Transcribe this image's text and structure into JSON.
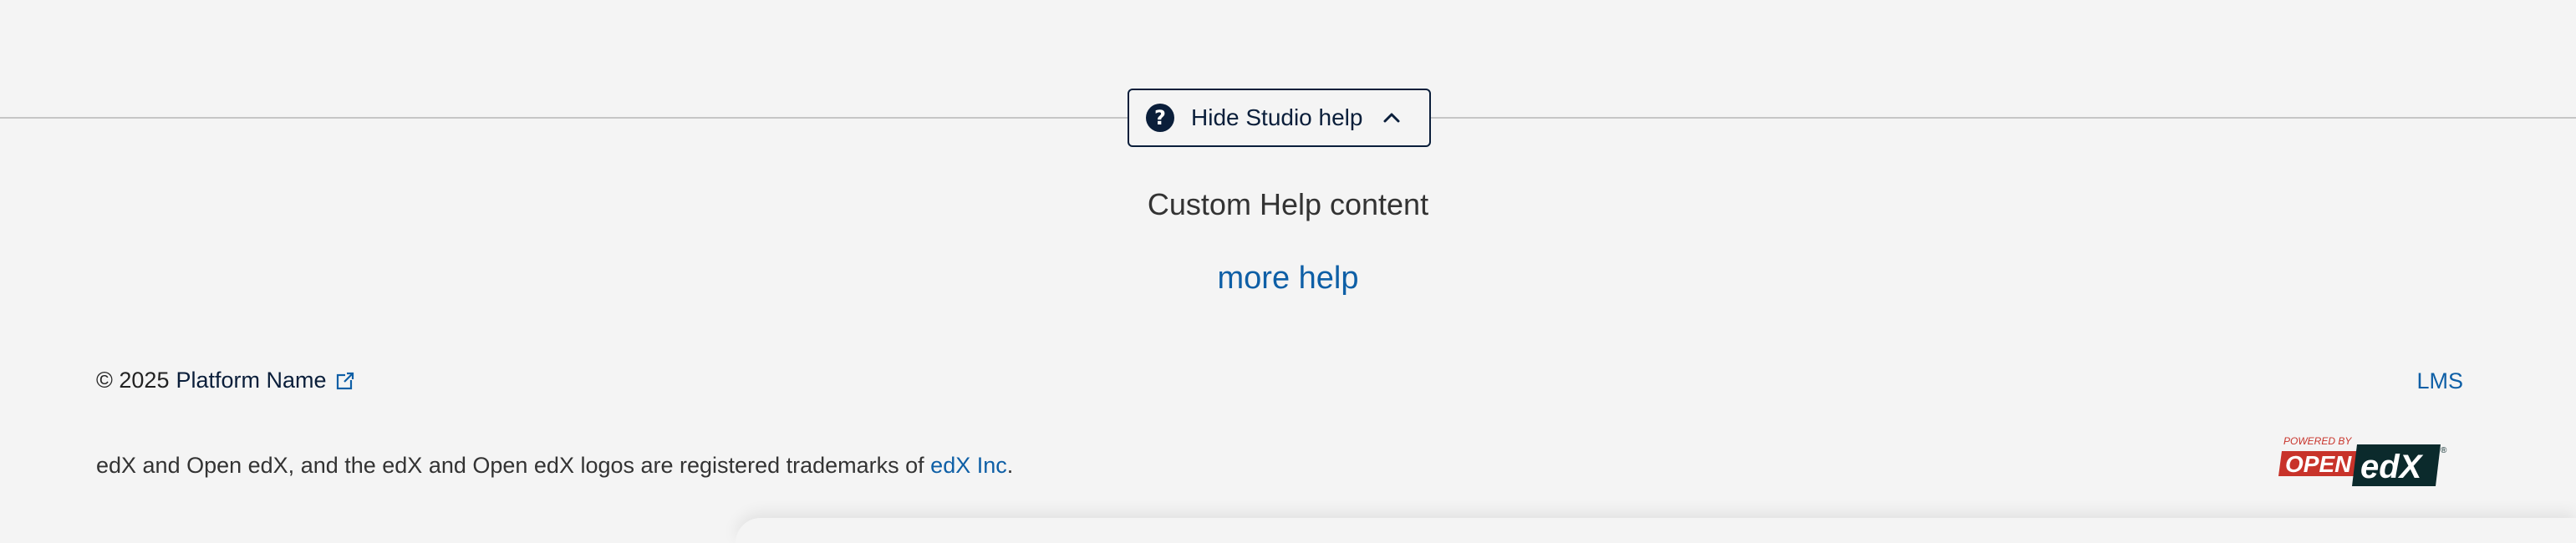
{
  "help_toggle": {
    "label": "Hide Studio help",
    "icon": "question-circle-icon",
    "chevron": "chevron-up-icon",
    "accent_color": "#0a1e3a"
  },
  "help_content": {
    "title": "Custom Help content",
    "more_help_label": "more help"
  },
  "footer": {
    "copyright_prefix": "© 2025",
    "platform_name": "Platform Name",
    "lms_label": "LMS",
    "trademark_text": "edX and Open edX, and the edX and Open edX logos are registered trademarks of",
    "trademark_link": "edX Inc",
    "trademark_suffix": ".",
    "logo": {
      "powered_by": "POWERED BY",
      "open": "OPEN",
      "edx": "edX",
      "registered": "®"
    },
    "link_color": "#0e5fa6"
  }
}
